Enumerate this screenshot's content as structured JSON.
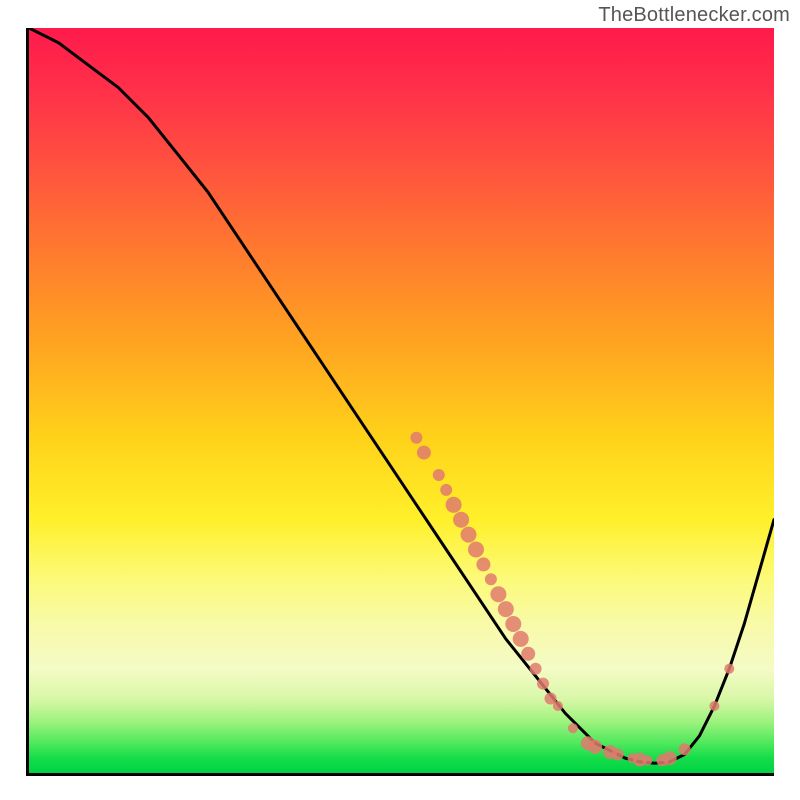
{
  "attribution": "TheBottlenecker.com",
  "chart_data": {
    "type": "line",
    "title": "",
    "xlabel": "",
    "ylabel": "",
    "xlim": [
      0,
      100
    ],
    "ylim": [
      0,
      100
    ],
    "series": [
      {
        "name": "bottleneck-curve",
        "x": [
          0,
          4,
          8,
          12,
          16,
          20,
          24,
          28,
          32,
          36,
          40,
          44,
          48,
          52,
          56,
          60,
          64,
          68,
          72,
          74,
          76,
          78,
          80,
          82,
          84,
          86,
          88,
          90,
          92,
          94,
          96,
          98,
          100
        ],
        "y": [
          100,
          98,
          95,
          92,
          88,
          83,
          78,
          72,
          66,
          60,
          54,
          48,
          42,
          36,
          30,
          24,
          18,
          13,
          8,
          6,
          4,
          3,
          2,
          1.5,
          1.3,
          1.5,
          2.5,
          5,
          9,
          14,
          20,
          27,
          34
        ]
      }
    ],
    "scatter_overlay": {
      "name": "highlight-points",
      "color": "#e07a6d",
      "points": [
        {
          "x": 52,
          "y": 45,
          "r": 6
        },
        {
          "x": 53,
          "y": 43,
          "r": 7
        },
        {
          "x": 55,
          "y": 40,
          "r": 6
        },
        {
          "x": 56,
          "y": 38,
          "r": 6
        },
        {
          "x": 57,
          "y": 36,
          "r": 8
        },
        {
          "x": 58,
          "y": 34,
          "r": 8
        },
        {
          "x": 59,
          "y": 32,
          "r": 8
        },
        {
          "x": 60,
          "y": 30,
          "r": 8
        },
        {
          "x": 61,
          "y": 28,
          "r": 7
        },
        {
          "x": 62,
          "y": 26,
          "r": 6
        },
        {
          "x": 63,
          "y": 24,
          "r": 8
        },
        {
          "x": 64,
          "y": 22,
          "r": 8
        },
        {
          "x": 65,
          "y": 20,
          "r": 8
        },
        {
          "x": 66,
          "y": 18,
          "r": 8
        },
        {
          "x": 67,
          "y": 16,
          "r": 7
        },
        {
          "x": 68,
          "y": 14,
          "r": 6
        },
        {
          "x": 69,
          "y": 12,
          "r": 6
        },
        {
          "x": 70,
          "y": 10,
          "r": 6
        },
        {
          "x": 71,
          "y": 9,
          "r": 5
        },
        {
          "x": 73,
          "y": 6,
          "r": 5
        },
        {
          "x": 75,
          "y": 4,
          "r": 7
        },
        {
          "x": 76,
          "y": 3.5,
          "r": 7
        },
        {
          "x": 78,
          "y": 2.8,
          "r": 7
        },
        {
          "x": 79,
          "y": 2.5,
          "r": 6
        },
        {
          "x": 81,
          "y": 2,
          "r": 5
        },
        {
          "x": 82,
          "y": 1.8,
          "r": 7
        },
        {
          "x": 83,
          "y": 1.7,
          "r": 5
        },
        {
          "x": 85,
          "y": 1.7,
          "r": 6
        },
        {
          "x": 86,
          "y": 2,
          "r": 7
        },
        {
          "x": 88,
          "y": 3.2,
          "r": 6
        },
        {
          "x": 92,
          "y": 9,
          "r": 5
        },
        {
          "x": 94,
          "y": 14,
          "r": 5
        }
      ]
    },
    "gradient_stops": [
      {
        "pos": 0.0,
        "color": "#ff1a4b"
      },
      {
        "pos": 0.3,
        "color": "#ff7a2e"
      },
      {
        "pos": 0.55,
        "color": "#ffd21a"
      },
      {
        "pos": 0.8,
        "color": "#f8faa8"
      },
      {
        "pos": 1.0,
        "color": "#00d244"
      }
    ]
  }
}
